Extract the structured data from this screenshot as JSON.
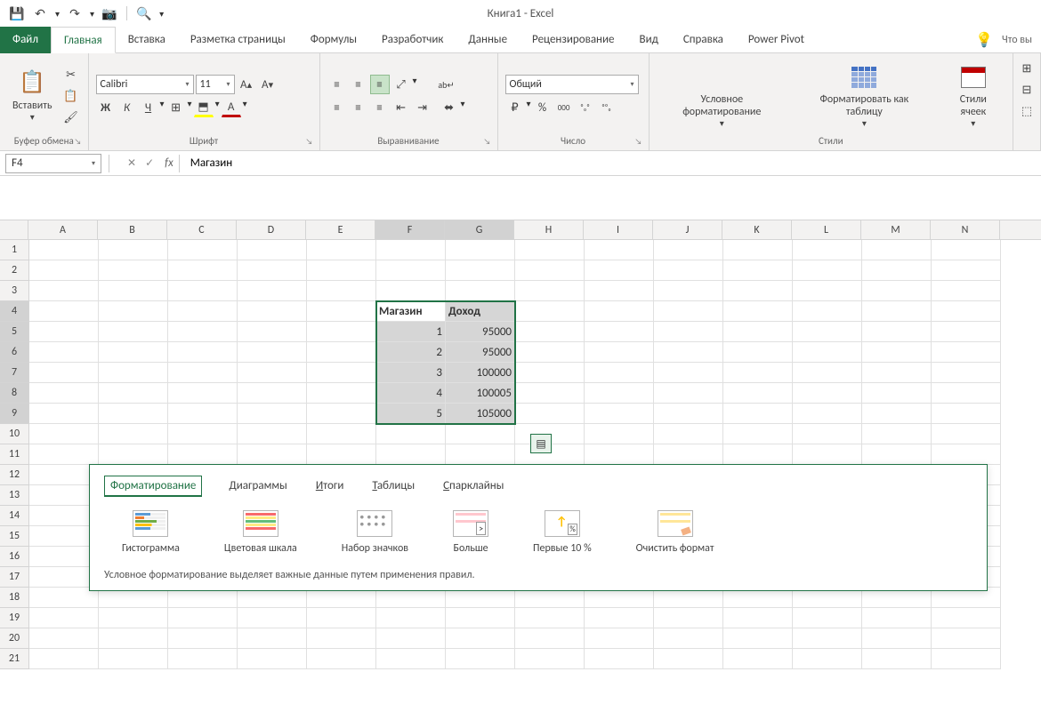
{
  "app_title": {
    "doc": "Книга1",
    "sep": " - ",
    "app": "Excel"
  },
  "qat": {
    "save": "💾",
    "undo": "↶",
    "redo": "↷",
    "camera": "📷",
    "preview": "🔍"
  },
  "tabs": {
    "file": "Файл",
    "home": "Главная",
    "insert": "Вставка",
    "page_layout": "Разметка страницы",
    "formulas": "Формулы",
    "developer": "Разработчик",
    "data": "Данные",
    "review": "Рецензирование",
    "view": "Вид",
    "help": "Справка",
    "power_pivot": "Power Pivot",
    "tell_me": "Что вы"
  },
  "ribbon": {
    "clipboard": {
      "label": "Буфер обмена",
      "paste": "Вставить",
      "cut": "✂",
      "copy": "📋",
      "painter": "🖌"
    },
    "font": {
      "label": "Шрифт",
      "name": "Calibri",
      "size": "11",
      "grow": "A▲",
      "shrink": "A▼",
      "bold": "Ж",
      "italic": "К",
      "underline": "Ч",
      "border": "⊞",
      "fill": "🪣",
      "color": "A"
    },
    "alignment": {
      "label": "Выравнивание",
      "top": "⬆",
      "middle": "≡",
      "bottom": "⬇",
      "orient": "⤡",
      "wrap": "ab↵",
      "left": "≡",
      "center": "≡",
      "right": "≡",
      "indent_dec": "⇤",
      "indent_inc": "⇥",
      "merge": "⬌"
    },
    "number": {
      "label": "Число",
      "format": "Общий",
      "currency": "💲",
      "percent": "%",
      "comma": "000",
      "inc_dec": "←.00",
      "dec_dec": ".00→"
    },
    "styles": {
      "label": "Стили",
      "cf": "Условное форматирование",
      "table": "Форматировать как таблицу",
      "cell_styles": "Стили ячеек"
    }
  },
  "name_box": "F4",
  "formula_value": "Магазин",
  "columns": [
    "A",
    "B",
    "C",
    "D",
    "E",
    "F",
    "G",
    "H",
    "I",
    "J",
    "K",
    "L",
    "M",
    "N"
  ],
  "rows": [
    "1",
    "2",
    "3",
    "4",
    "5",
    "6",
    "7",
    "8",
    "9",
    "10",
    "11",
    "12",
    "13",
    "14",
    "15",
    "16",
    "17",
    "18",
    "19",
    "20",
    "21"
  ],
  "cells": {
    "F4": "Магазин",
    "G4": "Доход",
    "F5": "1",
    "G5": "95000",
    "F6": "2",
    "G6": "95000",
    "F7": "3",
    "G7": "100000",
    "F8": "4",
    "G8": "100005",
    "F9": "5",
    "G9": "105000"
  },
  "qa": {
    "tabs": {
      "formatting": "Форматирование",
      "charts": "Диаграммы",
      "totals": "Итоги",
      "tables": "Таблицы",
      "sparklines": "Спарклайны"
    },
    "items": {
      "histogram": "Гистограмма",
      "color_scale": "Цветовая шкала",
      "icon_set": "Набор значков",
      "greater": "Больше",
      "top10": "Первые 10 %",
      "clear": "Очистить формат"
    },
    "hint": "Условное форматирование выделяет важные данные путем применения правил."
  }
}
